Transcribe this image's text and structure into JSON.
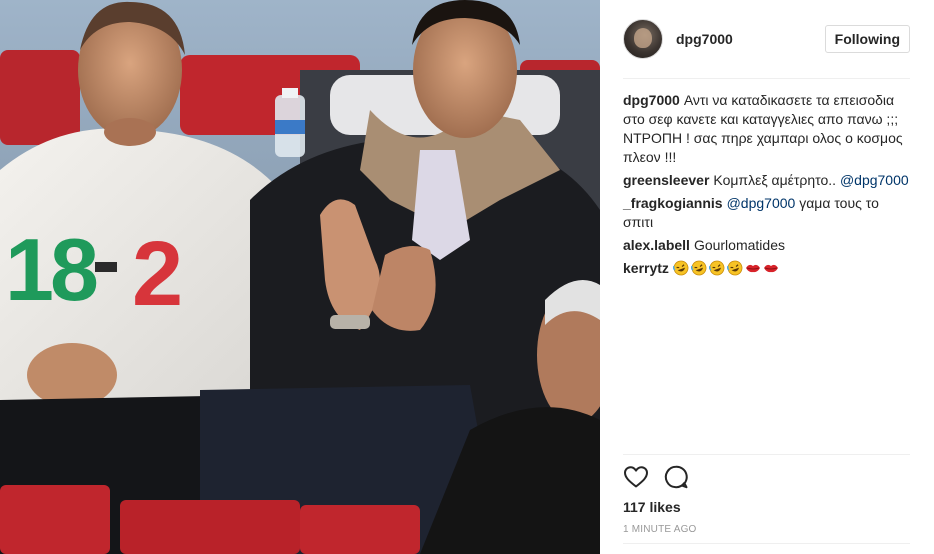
{
  "post": {
    "username": "dpg7000",
    "follow_label": "Following",
    "caption": {
      "user": "dpg7000",
      "text": "Αντι να καταδικασετε τα επεισοδια στο σεφ κανετε και καταγγελιες απο πανω ;;; ΝΤΡΟΠΗ ! σας πηρε χαμπαρι ολος ο κοσμος πλεον !!!"
    },
    "comments": [
      {
        "user": "greensleever",
        "text": "Κομπλεξ αμέτρητο.. ",
        "mention": "@dpg7000",
        "after": ""
      },
      {
        "user": "_fragkogiannis",
        "text": "",
        "mention": "@dpg7000",
        "after": " γαμα τους το σπιτι"
      },
      {
        "user": "alex.labell",
        "text": "Gourlomatides",
        "mention": "",
        "after": ""
      },
      {
        "user": "kerrytz",
        "emojis": [
          "rolling-laughing-emoji",
          "rolling-laughing-emoji",
          "rolling-laughing-emoji",
          "rolling-laughing-emoji",
          "kiss-lips-emoji",
          "kiss-lips-emoji"
        ]
      }
    ],
    "likes": "117 likes",
    "timestamp": "1 MINUTE AGO",
    "photo_shirt_text": "18 - 2",
    "icons": {
      "like": "heart-outline-icon",
      "comment": "comment-bubble-icon"
    },
    "colors": {
      "mention": "#003569",
      "timestamp": "#999999",
      "seat_red": "#c0262d"
    }
  }
}
